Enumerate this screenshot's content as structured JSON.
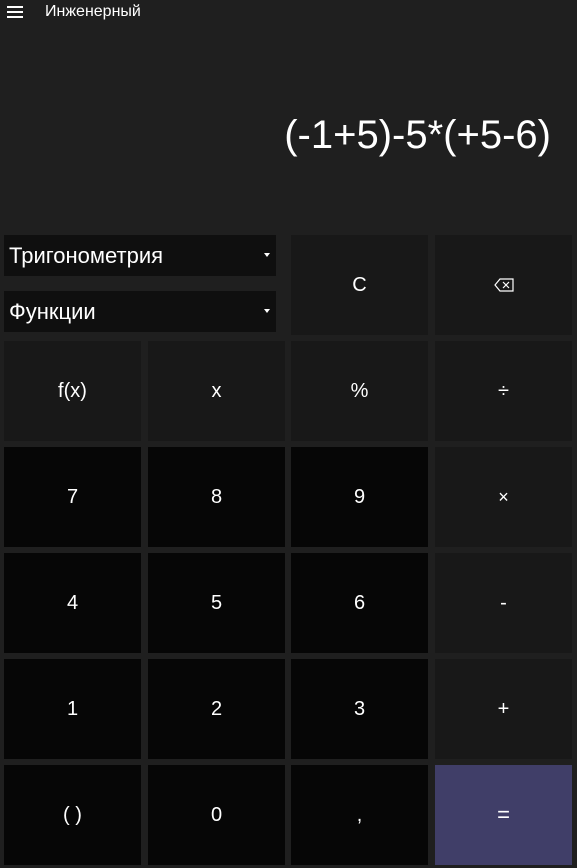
{
  "app": {
    "mode_title": "Инженерный"
  },
  "display": {
    "expression": "(-1+5)-5*(+5-6)"
  },
  "dropdowns": {
    "trig": "Тригонометрия",
    "functions": "Функции"
  },
  "keys": {
    "clear": "C",
    "fx": "f(x)",
    "x": "x",
    "percent": "%",
    "divide": "÷",
    "seven": "7",
    "eight": "8",
    "nine": "9",
    "multiply": "×",
    "four": "4",
    "five": "5",
    "six": "6",
    "minus": "-",
    "one": "1",
    "two": "2",
    "three": "3",
    "plus": "+",
    "parens": "( )",
    "zero": "0",
    "comma": ",",
    "equals": "="
  },
  "icons": {
    "menu": "hamburger-icon",
    "backspace": "backspace-icon"
  },
  "colors": {
    "background": "#1f1f1f",
    "equals_key": "#403e68",
    "number_key": "#060606",
    "function_key": "#181818"
  }
}
